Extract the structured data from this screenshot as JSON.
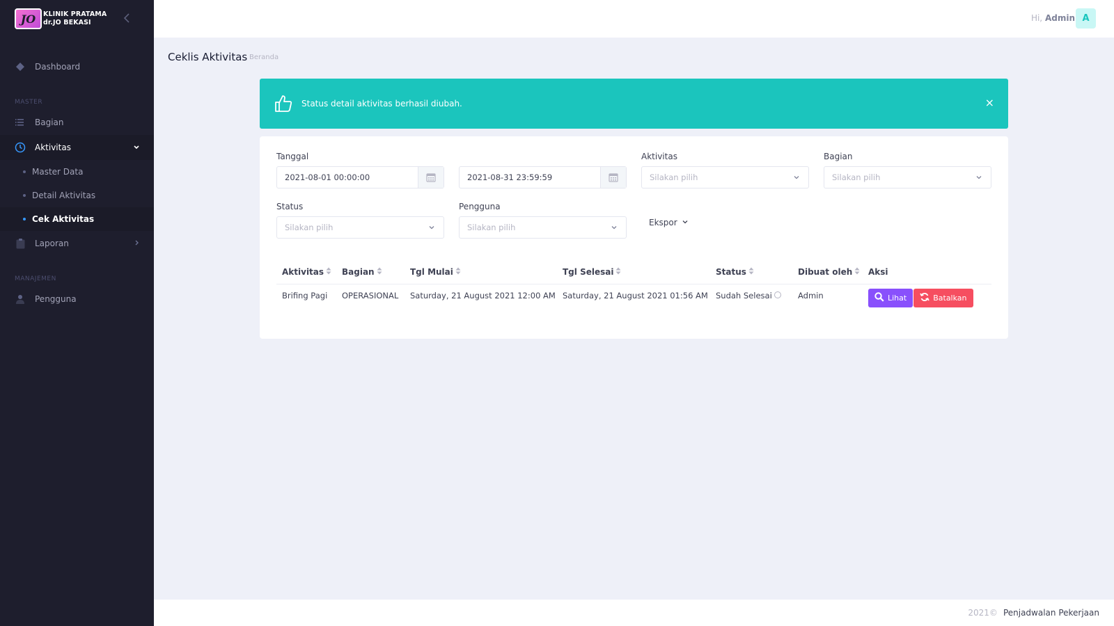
{
  "brand": {
    "logo_text": "JO",
    "line1": "KLINIK PRATAMA",
    "line2": "dr.JO BEKASI"
  },
  "sidebar": {
    "dashboard": "Dashboard",
    "section_master": "MASTER",
    "bagian": "Bagian",
    "aktivitas": "Aktivitas",
    "sub_items": [
      "Master Data",
      "Detail Aktivitas",
      "Cek Aktivitas"
    ],
    "laporan": "Laporan",
    "section_manajemen": "MANAJEMEN",
    "pengguna": "Pengguna"
  },
  "header": {
    "greeting": "Hi,",
    "user_name": "Admin",
    "avatar_letter": "A"
  },
  "page": {
    "title": "Ceklis Aktivitas",
    "breadcrumb": "Beranda"
  },
  "alert": {
    "message": "Status detail aktivitas berhasil diubah.",
    "close": "×"
  },
  "filters": {
    "tanggal_label": "Tanggal",
    "date_start": "2021-08-01 00:00:00",
    "date_end": "2021-08-31 23:59:59",
    "aktivitas_label": "Aktivitas",
    "aktivitas_placeholder": "Silakan pilih",
    "bagian_label": "Bagian",
    "bagian_placeholder": "Silakan pilih",
    "status_label": "Status",
    "status_placeholder": "Silakan pilih",
    "pengguna_label": "Pengguna",
    "pengguna_placeholder": "Silakan pilih",
    "ekspor": "Ekspor"
  },
  "table": {
    "headers": [
      "Aktivitas",
      "Bagian",
      "Tgl Mulai",
      "Tgl Selesai",
      "Status",
      "Dibuat oleh",
      "Aksi"
    ],
    "rows": [
      {
        "aktivitas": "Brifing Pagi",
        "bagian": "OPERASIONAL",
        "tgl_mulai": "Saturday, 21 August 2021 12:00 AM",
        "tgl_selesai": "Saturday, 21 August 2021 01:56 AM",
        "status": "Sudah Selesai",
        "dibuat_oleh": "Admin",
        "btn_lihat": "Lihat",
        "btn_batalkan": "Batalkan"
      }
    ]
  },
  "footer": {
    "year": "2021©",
    "app_name": "Penjadwalan Pekerjaan"
  },
  "colors": {
    "sidebar_bg": "#1e1e2d",
    "alert_bg": "#1bc5bd",
    "btn_lihat": "#8950fc",
    "btn_batalkan": "#f64e60",
    "active_dot": "#3699ff"
  }
}
